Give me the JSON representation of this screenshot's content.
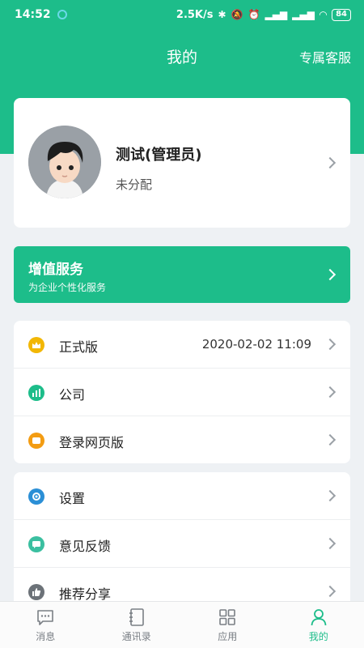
{
  "status_bar": {
    "time": "14:52",
    "speed": "2.5K/s",
    "battery": "84"
  },
  "nav": {
    "title": "我的",
    "action": "专属客服"
  },
  "profile": {
    "name": "测试(管理员)",
    "dept": "未分配"
  },
  "vas": {
    "title": "增值服务",
    "subtitle": "为企业个性化服务"
  },
  "group1": [
    {
      "label": "正式版",
      "value": "2020-02-02 11:09",
      "icon": "crown-icon",
      "color": "#f2b705"
    },
    {
      "label": "公司",
      "value": "",
      "icon": "company-chart-icon",
      "color": "#1dbd8a"
    },
    {
      "label": "登录网页版",
      "value": "",
      "icon": "web-login-icon",
      "color": "#f39c12"
    }
  ],
  "group2": [
    {
      "label": "设置",
      "icon": "gear-icon",
      "color": "#2b8fd6"
    },
    {
      "label": "意见反馈",
      "icon": "feedback-icon",
      "color": "#3bbfa0"
    },
    {
      "label": "推荐分享",
      "icon": "thumbs-up-icon",
      "color": "#6c7278"
    }
  ],
  "tabs": [
    {
      "label": "消息",
      "active": false
    },
    {
      "label": "通讯录",
      "active": false
    },
    {
      "label": "应用",
      "active": false
    },
    {
      "label": "我的",
      "active": true
    }
  ],
  "colors": {
    "primary": "#1dbd8a",
    "background": "#eef1f4"
  }
}
